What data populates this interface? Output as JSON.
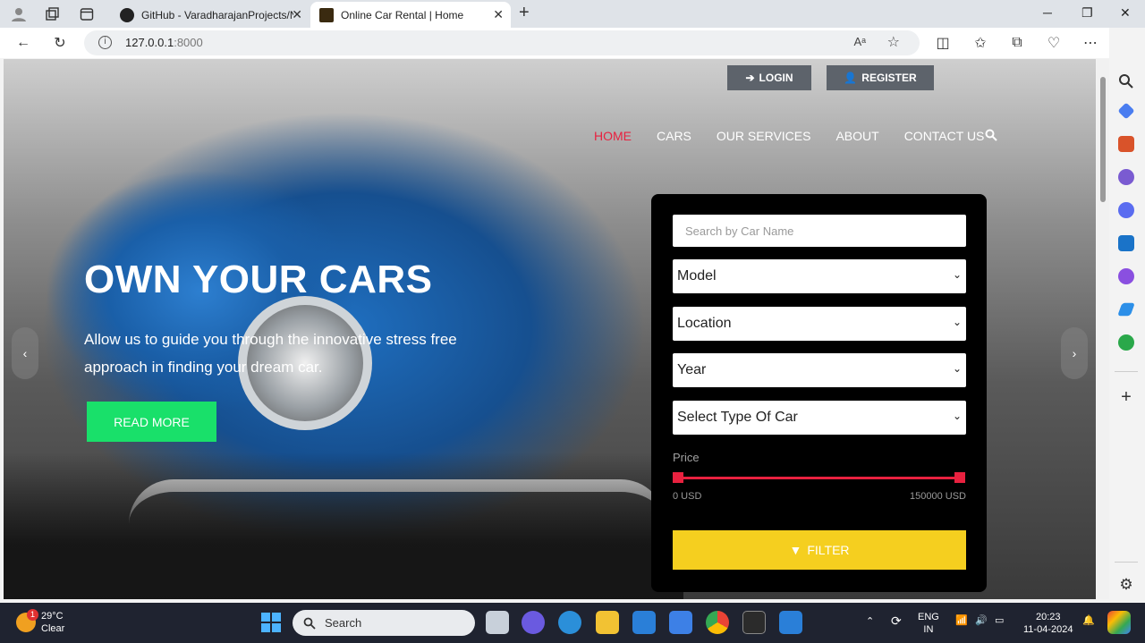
{
  "browser": {
    "tabs": [
      {
        "title": "GitHub - VaradharajanProjects/N"
      },
      {
        "title": "Online Car Rental | Home"
      }
    ],
    "url_host": "127.0.0.1",
    "url_port": ":8000"
  },
  "site": {
    "auth": {
      "login": "LOGIN",
      "register": "REGISTER"
    },
    "nav": [
      "HOME",
      "CARS",
      "OUR SERVICES",
      "ABOUT",
      "CONTACT US"
    ],
    "hero": {
      "title": "OWN YOUR CARS",
      "text": "Allow us to guide you through the innovative stress free approach in finding your dream car.",
      "cta": "READ MORE"
    },
    "filter": {
      "search_placeholder": "Search by Car Name",
      "selects": [
        "Model",
        "Location",
        "Year",
        "Select Type Of Car"
      ],
      "price_label": "Price",
      "price_min": "0 USD",
      "price_max": "150000 USD",
      "button": "FILTER"
    }
  },
  "taskbar": {
    "temp": "29°C",
    "condition": "Clear",
    "weather_badge": "1",
    "search": "Search",
    "lang_top": "ENG",
    "lang_bottom": "IN",
    "time": "20:23",
    "date": "11-04-2024"
  },
  "colors": {
    "nav_active": "#e8213f",
    "cta": "#19e06a",
    "filter_button": "#f5cf1f"
  }
}
